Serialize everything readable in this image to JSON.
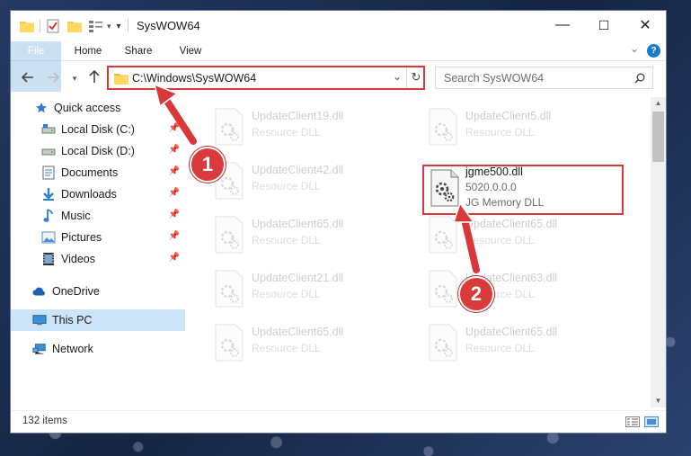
{
  "window": {
    "title": "SysWOW64",
    "controls": {
      "minimize": "—",
      "maximize": "☐",
      "close": "✕"
    }
  },
  "ribbon": {
    "tabs": [
      "File",
      "Home",
      "Share",
      "View"
    ],
    "collapse_glyph": "⌄",
    "help_glyph": "?"
  },
  "address_bar": {
    "path": "C:\\Windows\\SysWOW64",
    "dropdown_glyph": "⌄",
    "refresh_glyph": "↻"
  },
  "search": {
    "placeholder": "Search SysWOW64",
    "icon_glyph": "⌕"
  },
  "sidebar": {
    "items": [
      {
        "label": "Quick access",
        "icon": "star-icon",
        "pinned": false
      },
      {
        "label": "Local Disk (C:)",
        "icon": "drive-icon",
        "pinned": true
      },
      {
        "label": "Local Disk (D:)",
        "icon": "drive-icon",
        "pinned": true
      },
      {
        "label": "Documents",
        "icon": "documents-icon",
        "pinned": true
      },
      {
        "label": "Downloads",
        "icon": "download-icon",
        "pinned": true
      },
      {
        "label": "Music",
        "icon": "music-icon",
        "pinned": true
      },
      {
        "label": "Pictures",
        "icon": "pictures-icon",
        "pinned": true
      },
      {
        "label": "Videos",
        "icon": "videos-icon",
        "pinned": true
      },
      {
        "label": "OneDrive",
        "icon": "cloud-icon",
        "pinned": false
      },
      {
        "label": "This PC",
        "icon": "computer-icon",
        "pinned": false,
        "selected": true
      },
      {
        "label": "Network",
        "icon": "network-icon",
        "pinned": false
      }
    ],
    "pin_glyph": "📌"
  },
  "files": {
    "left_column": [
      {
        "name": "UpdateClient19.dll",
        "desc": "Resource DLL"
      },
      {
        "name": "UpdateClient42.dll",
        "desc": "Resource DLL"
      },
      {
        "name": "UpdateClient65.dll",
        "desc": "Resource DLL"
      },
      {
        "name": "UpdateClient21.dll",
        "desc": "Resource DLL"
      },
      {
        "name": "UpdateClient65.dll",
        "desc": "Resource DLL"
      }
    ],
    "right_column": [
      {
        "name": "UpdateClient5.dll",
        "desc": "Resource DLL"
      },
      {
        "name": "UpdateClient65.dll",
        "desc": "Resource DLL"
      },
      {
        "name": "UpdateClient63.dll",
        "desc": "Resource DLL"
      },
      {
        "name": "UpdateClient65.dll",
        "desc": "Resource DLL"
      }
    ],
    "featured": {
      "name": "jgme500.dll",
      "version": "5020.0.0.0",
      "description": "JG Memory DLL"
    }
  },
  "status_bar": {
    "item_count": "132 items"
  },
  "annotations": {
    "step1": "1",
    "step2": "2",
    "color": "#d9383a"
  }
}
